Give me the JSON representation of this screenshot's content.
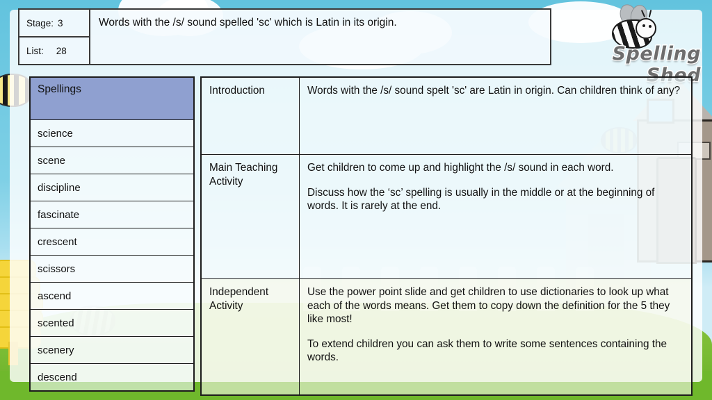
{
  "brand": {
    "logo_text": "Spelling Shed",
    "bee_icon": "bee-icon"
  },
  "header": {
    "stage_label": "Stage:",
    "stage_value": "3",
    "list_label": "List:",
    "list_value": "28",
    "title": "Words with the /s/ sound spelled 'sc' which is Latin in its origin."
  },
  "spellings": {
    "heading": "Spellings",
    "words": [
      "science",
      "scene",
      "discipline",
      "fascinate",
      "crescent",
      "scissors",
      "ascend",
      "scented",
      "scenery",
      "descend"
    ]
  },
  "lesson": {
    "introduction": {
      "label": "Introduction",
      "paragraphs": [
        "Words with the /s/ sound spelt 'sc' are Latin in origin. Can children think of any?"
      ]
    },
    "main_teaching": {
      "label": "Main Teaching Activity",
      "paragraphs": [
        "Get children to come up and highlight the /s/ sound in each word.",
        "Discuss how the ‘sc’ spelling is usually in the middle or at the beginning of words. It is rarely at the end."
      ]
    },
    "independent": {
      "label": "Independent Activity",
      "paragraphs": [
        "Use the power point slide and get children to use dictionaries to look up what each of the words means. Get them to copy down the definition for the 5 they like most!",
        "To extend children you can ask them to write some sentences containing the words."
      ]
    }
  },
  "colors": {
    "sky": "#5cc0dd",
    "grass": "#7ec12e",
    "heading_blue": "#8fa0d0",
    "hive_yellow": "#f5d53a",
    "panel_white": "#ffffff"
  }
}
